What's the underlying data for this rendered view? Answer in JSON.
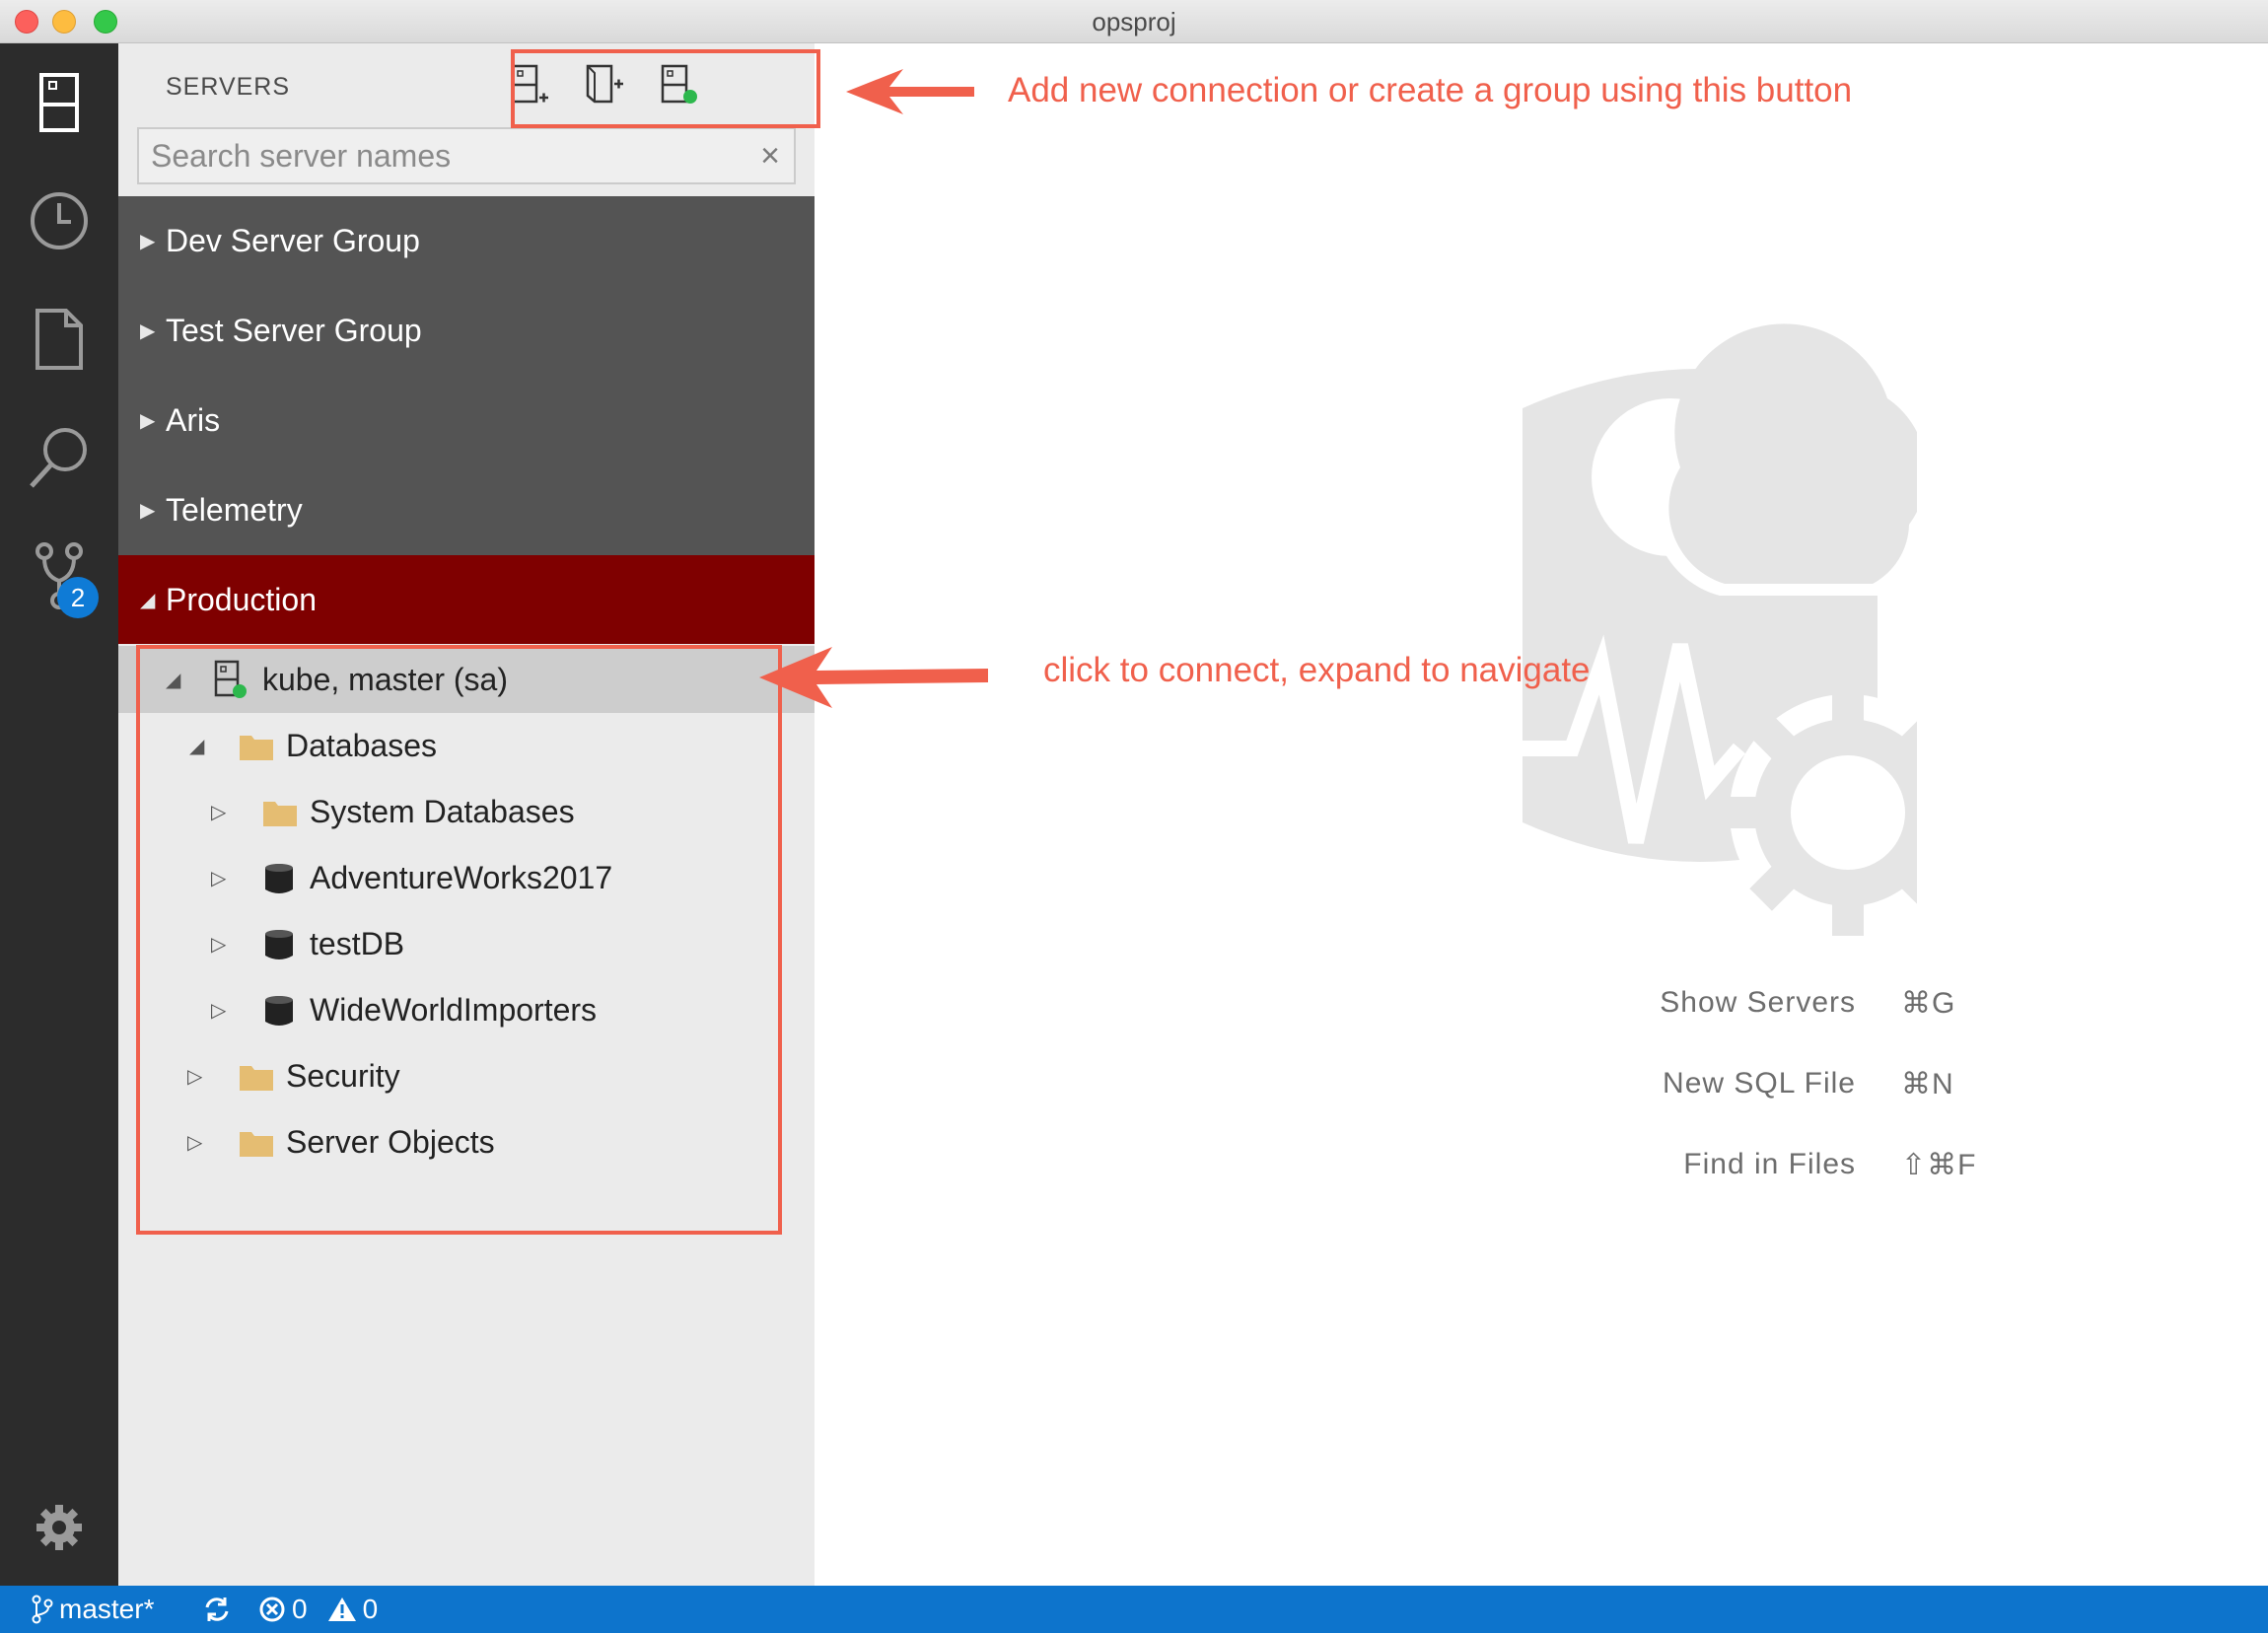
{
  "window": {
    "title": "opsproj"
  },
  "activity_bar": {
    "items": [
      {
        "icon": "server-icon"
      },
      {
        "icon": "history-icon"
      },
      {
        "icon": "file-icon"
      },
      {
        "icon": "search-icon"
      },
      {
        "icon": "source-control-icon",
        "badge": "2"
      }
    ],
    "settings_icon": "gear-icon"
  },
  "sidebar": {
    "header": "SERVERS",
    "actions": [
      "new-connection-icon",
      "new-group-icon",
      "active-connections-icon"
    ],
    "search": {
      "placeholder": "Search server names",
      "clear": "×"
    },
    "groups": [
      {
        "label": "Dev Server Group",
        "expanded": false
      },
      {
        "label": "Test Server Group",
        "expanded": false
      },
      {
        "label": "Aris",
        "expanded": false
      },
      {
        "label": "Telemetry",
        "expanded": false
      },
      {
        "label": "Production",
        "expanded": true
      }
    ],
    "tree": {
      "server": "kube, master (sa)",
      "databases": "Databases",
      "db_items": [
        "System Databases",
        "AdventureWorks2017",
        "testDB",
        "WideWorldImporters"
      ],
      "security": "Security",
      "server_objects": "Server Objects"
    }
  },
  "main": {
    "shortcuts": [
      {
        "label": "Show Servers",
        "keys": "⌘G"
      },
      {
        "label": "New SQL File",
        "keys": "⌘N"
      },
      {
        "label": "Find in Files",
        "keys": "⇧⌘F"
      }
    ]
  },
  "statusbar": {
    "branch": "master*",
    "errors": "0",
    "warnings": "0"
  },
  "annotations": {
    "toolbar_note": "Add new connection or create a group using this button",
    "tree_note": "click to connect, expand to navigate"
  },
  "colors": {
    "accent": "#0d74cc",
    "active_group": "#7f0000",
    "group_bg": "#545454",
    "annotation": "#f0604c",
    "connected": "#2db84d"
  }
}
